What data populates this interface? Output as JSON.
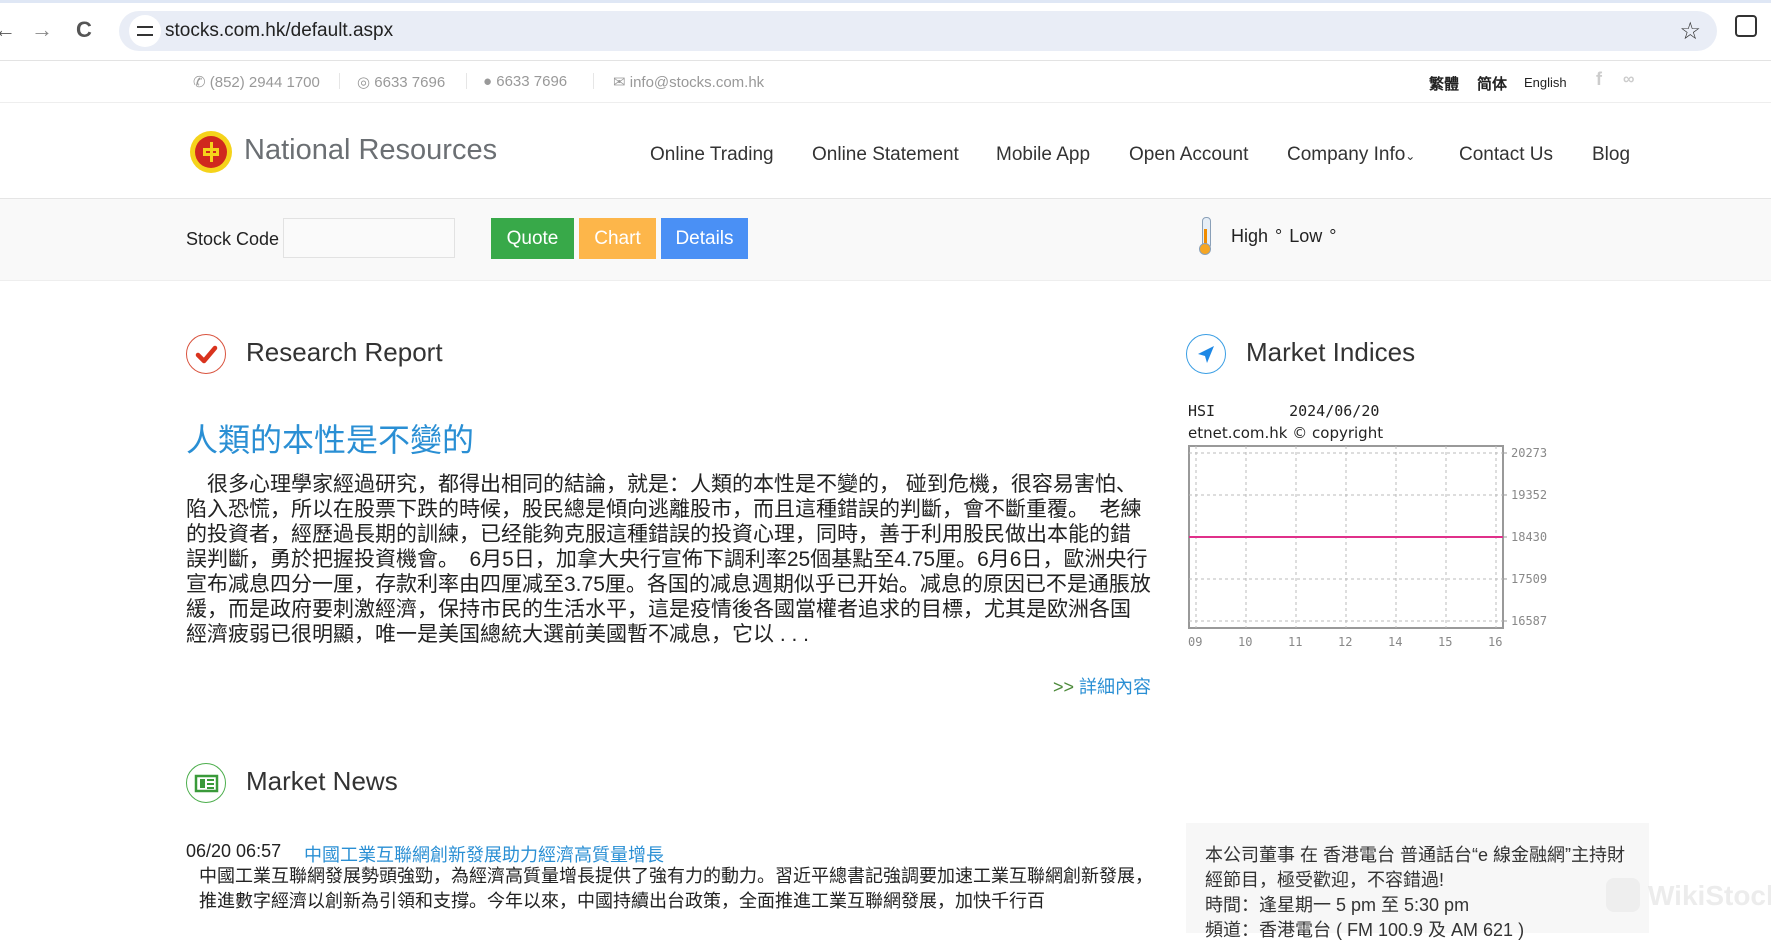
{
  "browser": {
    "back_icon": "←",
    "forward_icon": "→",
    "reload_icon": "C",
    "url": "stocks.com.hk/default.aspx",
    "bookmark_icon": "☆"
  },
  "contact": {
    "phone": "(852) 2944 1700",
    "whatsapp": "6633 7696",
    "wechat": "6633 7696",
    "email": "info@stocks.com.hk",
    "languages": [
      "繁體",
      "简体",
      "English"
    ],
    "social": [
      "f",
      "weibo"
    ]
  },
  "header": {
    "brand": "National Resources",
    "nav": [
      "Online Trading",
      "Online Statement",
      "Mobile App",
      "Open Account",
      "Company Info",
      "Contact Us",
      "Blog"
    ],
    "company_info_caret": "⌄"
  },
  "search": {
    "label": "Stock Code",
    "value": "",
    "placeholder": "",
    "buttons": [
      {
        "label": "Quote",
        "color": "#38a949"
      },
      {
        "label": "Chart",
        "color": "#fdb64a"
      },
      {
        "label": "Details",
        "color": "#4a90f5"
      }
    ],
    "weather": "High °   Low °"
  },
  "research": {
    "heading": "Research Report",
    "title": "人類的本性是不變的",
    "body": "　很多心理學家經過研究，都得出相同的結論，就是：人類的本性是不變的， 碰到危機，很容易害怕、陷入恐慌，所以在股票下跌的時候，股民總是傾向逃離股市，而且這種錯誤的判斷，會不斷重覆。　老練的投資者，經歷過長期的訓練，已经能夠克服這種錯誤的投資心理，同時，善于利用股民做出本能的錯誤判斷，勇於把握投資機會。　6月5日，加拿大央行宣佈下調利率25個基點至4.75厘。6月6日，歐洲央行宣布减息四分一厘，存款利率由四厘减至3.75厘。各国的减息週期似乎已开始。减息的原因已不是通脹放緩，而是政府要刺激經濟，保持市民的生活水平，這是疫情後各國當權者追求的目標，尤其是欧洲各国經濟疲弱已很明顯，唯一是美国總統大選前美國暫不减息，它以 . . .",
    "more_arrow": ">>",
    "more_label": "詳細內容"
  },
  "indices": {
    "heading": "Market Indices",
    "index_name": "HSI",
    "date": "2024/06/20",
    "source": "etnet.com.hk © copyright"
  },
  "chart_data": {
    "type": "line",
    "title": "HSI 2024/06/20",
    "x": [
      "09",
      "10",
      "11",
      "12",
      "14",
      "15",
      "16"
    ],
    "y_ticks": [
      20273,
      19352,
      18430,
      17509,
      16587
    ],
    "ylim": [
      16587,
      20273
    ],
    "series": [
      {
        "name": "HSI",
        "color": "#e0308a",
        "values": [
          18430,
          18430,
          18430,
          18430,
          18430,
          18430,
          18430
        ]
      }
    ],
    "grid": true,
    "y_axis_side": "right",
    "xlabel": "",
    "ylabel": ""
  },
  "news": {
    "heading": "Market News",
    "items": [
      {
        "time": "06/20 06:57",
        "headline": "中國工業互聯網創新發展助力經濟高質量增長",
        "summary": "中國工業互聯網發展勢頭強勁，為經濟高質量增長提供了強有力的動力。習近平總書記強調要加速工業互聯網創新發展，推進數字經濟以創新為引領和支撐。今年以來，中國持續出台政策，全面推進工業互聯網發展，加快千行百"
      }
    ]
  },
  "promo": {
    "lines": [
      "本公司董事 在 香港電台 普通話台“e 線金融網”主持財經節目，極受歡迎，不容錯過!",
      "時間：逢星期一 5 pm 至 5:30 pm",
      "頻道：香港電台 ( FM 100.9 及 AM 621 )"
    ]
  },
  "watermark": "WikiStock"
}
